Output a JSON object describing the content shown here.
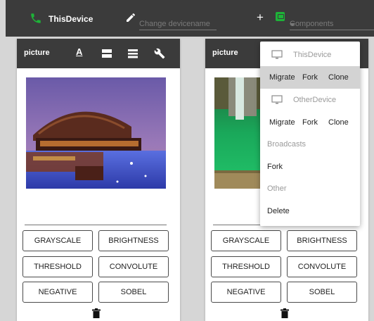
{
  "topbar": {
    "device_name": "ThisDevice",
    "name_placeholder": "Change devicename",
    "add_label": "+",
    "components_placeholder": "Components"
  },
  "cards": [
    {
      "title": "picture",
      "buttons": [
        "GRAYSCALE",
        "BRIGHTNESS",
        "THRESHOLD",
        "CONVOLUTE",
        "NEGATIVE",
        "SOBEL"
      ]
    },
    {
      "title": "picture",
      "buttons": [
        "GRAYSCALE",
        "BRIGHTNESS",
        "THRESHOLD",
        "CONVOLUTE",
        "NEGATIVE",
        "SOBEL"
      ]
    }
  ],
  "menu": {
    "this_device": "ThisDevice",
    "this_actions": [
      "Migrate",
      "Fork",
      "Clone"
    ],
    "other_device": "OtherDevice",
    "other_actions": [
      "Migrate",
      "Fork",
      "Clone"
    ],
    "broadcasts_header": "Broadcasts",
    "broadcast_item": "Fork",
    "other_header": "Other",
    "other_item": "Delete"
  },
  "icons": {
    "phone": "phone-icon",
    "edit": "pencil-icon",
    "components": "component-icon",
    "font": "font-icon",
    "layout1": "view-agenda-icon",
    "layout2": "view-list-icon",
    "settings": "wrench-icon",
    "delete": "trash-icon",
    "monitor": "monitor-icon"
  },
  "colors": {
    "topbar": "#3b3b3b",
    "accent_green": "#1db338",
    "selected_row": "#d3d3d3"
  }
}
